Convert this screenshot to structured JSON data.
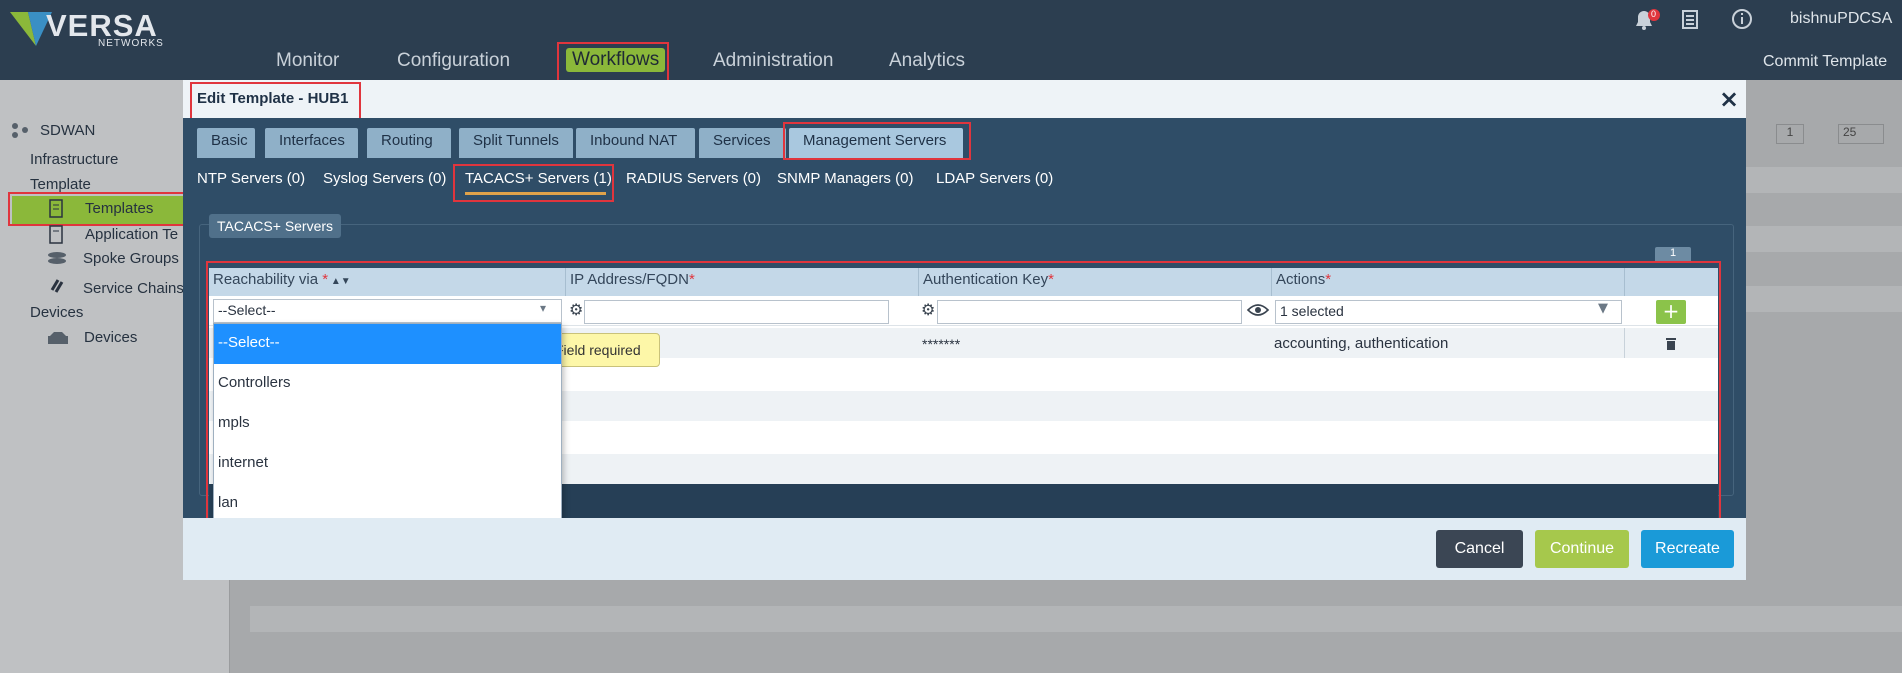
{
  "app": {
    "logo_text": "VERSA",
    "logo_sub": "NETWORKS",
    "user": "bishnuPDCSA",
    "notifications_count": "0",
    "commit_label": "Commit Template"
  },
  "nav": [
    "Monitor",
    "Configuration",
    "Workflows",
    "Administration",
    "Analytics"
  ],
  "sidebar": {
    "root": "SDWAN",
    "items": [
      "Infrastructure",
      "Template",
      "Templates",
      "Application Te",
      "Spoke Groups",
      "Service Chains",
      "Devices",
      "Devices"
    ]
  },
  "background_pager": {
    "page": "1",
    "page_size": "25"
  },
  "modal": {
    "title": "Edit Template - HUB1",
    "close": "×",
    "tabs": [
      "Basic",
      "Interfaces",
      "Routing",
      "Split Tunnels",
      "Inbound NAT",
      "Services",
      "Management Servers"
    ],
    "subtabs": [
      "NTP Servers (0)",
      "Syslog Servers (0)",
      "TACACS+ Servers (1)",
      "RADIUS Servers (0)",
      "SNMP Managers (0)",
      "LDAP Servers (0)"
    ],
    "section": "TACACS+ Servers",
    "pager": "1",
    "columns": [
      "Reachability via",
      "IP Address/FQDN",
      "Authentication Key",
      "Actions"
    ],
    "new_row": {
      "reachability": "--Select--",
      "actions": "1 selected"
    },
    "rows": [
      {
        "auth_key": "*******",
        "actions": "accounting, authentication"
      }
    ],
    "dropdown_options": [
      "--Select--",
      "Controllers",
      "mpls",
      "internet",
      "lan"
    ],
    "tooltip": "Field required",
    "buttons": {
      "cancel": "Cancel",
      "continue": "Continue",
      "recreate": "Recreate"
    }
  },
  "colors": {
    "topbar": "#2c3e50",
    "workflow_accent": "#8bb83a",
    "highlight": "#e0353d",
    "recreate": "#1a9ad8",
    "continue": "#a6c84c",
    "cancel": "#3b4654"
  }
}
